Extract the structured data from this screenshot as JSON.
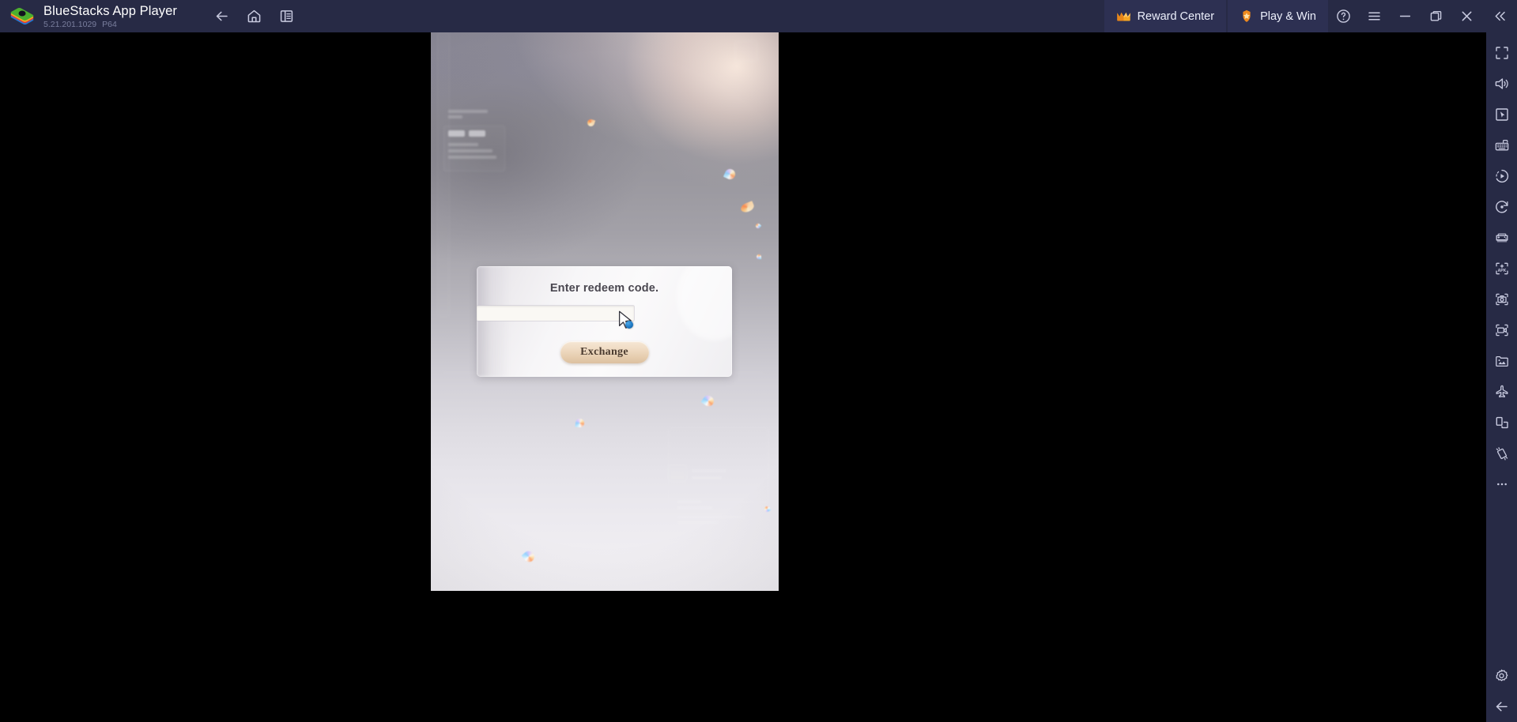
{
  "titlebar": {
    "app_name": "BlueStacks App Player",
    "version": "5.21.201.1029",
    "build": "P64",
    "logo_icon": "bluestacks-logo-icon",
    "nav": [
      {
        "icon": "back-arrow-icon",
        "name": "back-button"
      },
      {
        "icon": "home-icon",
        "name": "home-button"
      },
      {
        "icon": "multi-instance-icon",
        "name": "instance-manager-button"
      }
    ],
    "reward_center": {
      "label": "Reward Center",
      "icon": "crown-icon"
    },
    "play_and_win": {
      "label": "Play & Win",
      "icon": "star-badge-icon"
    },
    "window_controls": [
      {
        "icon": "help-circle-icon",
        "name": "help-button"
      },
      {
        "icon": "hamburger-menu-icon",
        "name": "menu-button"
      },
      {
        "icon": "minimize-icon",
        "name": "minimize-button"
      },
      {
        "icon": "restore-icon",
        "name": "restore-button"
      },
      {
        "icon": "close-icon",
        "name": "close-button"
      },
      {
        "icon": "double-chevron-left-icon",
        "name": "collapse-sidebar-button"
      }
    ]
  },
  "sidebar": {
    "items": [
      {
        "icon": "fullscreen-icon",
        "name": "sidebar-fullscreen"
      },
      {
        "icon": "volume-icon",
        "name": "sidebar-volume"
      },
      {
        "icon": "cursor-pointer-icon",
        "name": "sidebar-game-controls"
      },
      {
        "icon": "keyboard-icon",
        "name": "sidebar-keyboard-controls"
      },
      {
        "icon": "macro-play-icon",
        "name": "sidebar-macro-recorder"
      },
      {
        "icon": "rotate-icon",
        "name": "sidebar-rotate"
      },
      {
        "icon": "gamepad-icon",
        "name": "sidebar-gamepad"
      },
      {
        "icon": "apk-install-icon",
        "name": "sidebar-install-apk"
      },
      {
        "icon": "screenshot-camera-icon",
        "name": "sidebar-screenshot"
      },
      {
        "icon": "video-record-icon",
        "name": "sidebar-record-screen"
      },
      {
        "icon": "media-gallery-icon",
        "name": "sidebar-media-manager"
      },
      {
        "icon": "airplane-icon",
        "name": "sidebar-eco-mode"
      },
      {
        "icon": "multi-instance-icon",
        "name": "sidebar-multi-instance"
      },
      {
        "icon": "shake-tilt-icon",
        "name": "sidebar-shake"
      },
      {
        "icon": "more-dots-icon",
        "name": "sidebar-more-options"
      }
    ],
    "bottom_items": [
      {
        "icon": "gear-icon",
        "name": "sidebar-settings"
      },
      {
        "icon": "back-arrow-icon",
        "name": "sidebar-back"
      }
    ]
  },
  "game": {
    "dialog": {
      "title": "Enter redeem code.",
      "input_value": "",
      "input_placeholder": "",
      "button_label": "Exchange"
    },
    "cursor": {
      "icon": "arrow-busy-cursor-icon"
    }
  },
  "colors": {
    "titlebar_bg": "#272a45",
    "pill_bg": "#2d3052",
    "icon_stroke": "#c9cbe0",
    "accent_crown": "#f5a623",
    "accent_star": "#f08a1d",
    "dialog_button": "#e6cdae",
    "canvas_black": "#000000"
  }
}
